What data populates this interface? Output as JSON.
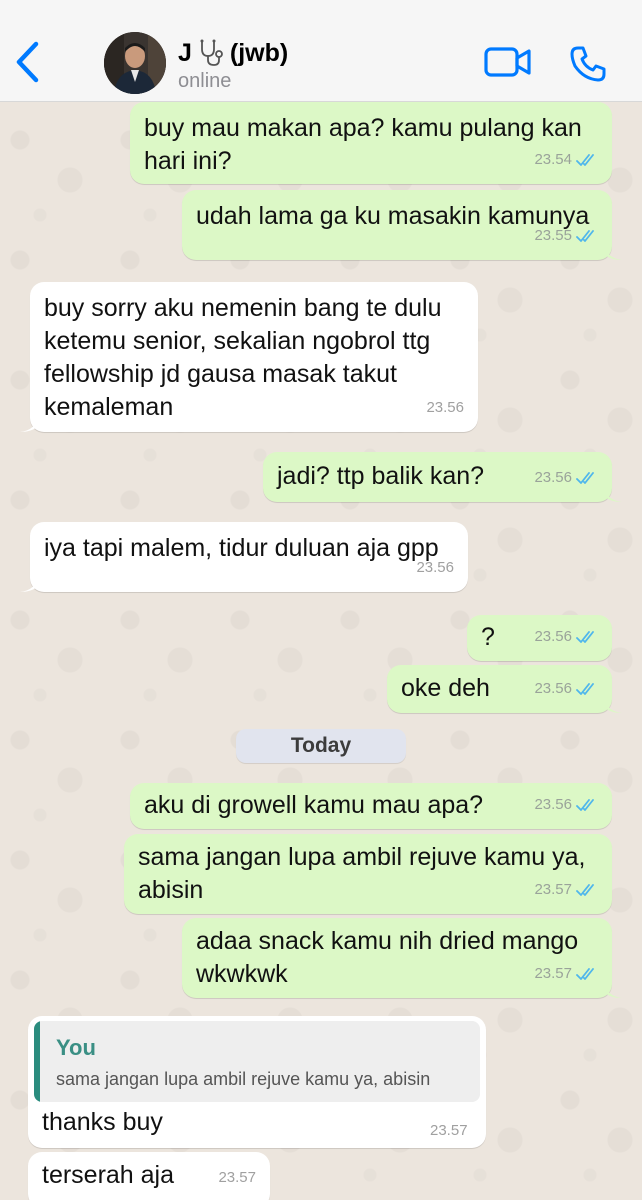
{
  "header": {
    "contact_name_prefix": "J",
    "contact_name_suffix": "(jwb)",
    "status": "online",
    "icons": [
      "chevron-left-icon",
      "stethoscope-icon",
      "video-icon",
      "phone-icon"
    ]
  },
  "colors": {
    "accent": "#007aff",
    "outgoing_bubble": "#dcf8c6",
    "incoming_bubble": "#ffffff",
    "read_ticks": "#4fb6ec",
    "quote_bar": "#2a8c7e"
  },
  "messages": [
    {
      "direction": "out",
      "text": "buy mau makan apa? kamu pulang kan hari ini?",
      "time": "23.54"
    },
    {
      "direction": "out",
      "text": "udah lama ga ku masakin kamunya",
      "time": "23.55"
    },
    {
      "direction": "in",
      "text": "buy sorry aku nemenin bang te dulu ketemu senior, sekalian ngobrol ttg fellowship jd gausa masak takut kemaleman",
      "time": "23.56"
    },
    {
      "direction": "out",
      "text": "jadi? ttp balik kan?",
      "time": "23.56"
    },
    {
      "direction": "in",
      "text": "iya tapi malem, tidur duluan aja gpp",
      "time": "23.56"
    },
    {
      "direction": "out",
      "text": "?",
      "time": "23.56"
    },
    {
      "direction": "out",
      "text": "oke deh",
      "time": "23.56"
    },
    {
      "direction": "out",
      "text": "aku di growell kamu mau apa?",
      "time": "23.56"
    },
    {
      "direction": "out",
      "text": "sama jangan lupa ambil rejuve kamu ya, abisin",
      "time": "23.57"
    },
    {
      "direction": "out",
      "text": "adaa snack kamu nih dried mango wkwkwk",
      "time": "23.57"
    },
    {
      "direction": "in",
      "text": "thanks buy",
      "time": "23.57",
      "reply_to": {
        "author": "You",
        "text": "sama jangan lupa ambil rejuve kamu ya, abisin"
      }
    },
    {
      "direction": "in",
      "text": "terserah aja",
      "time": "23.57"
    }
  ],
  "date_separator": "Today"
}
